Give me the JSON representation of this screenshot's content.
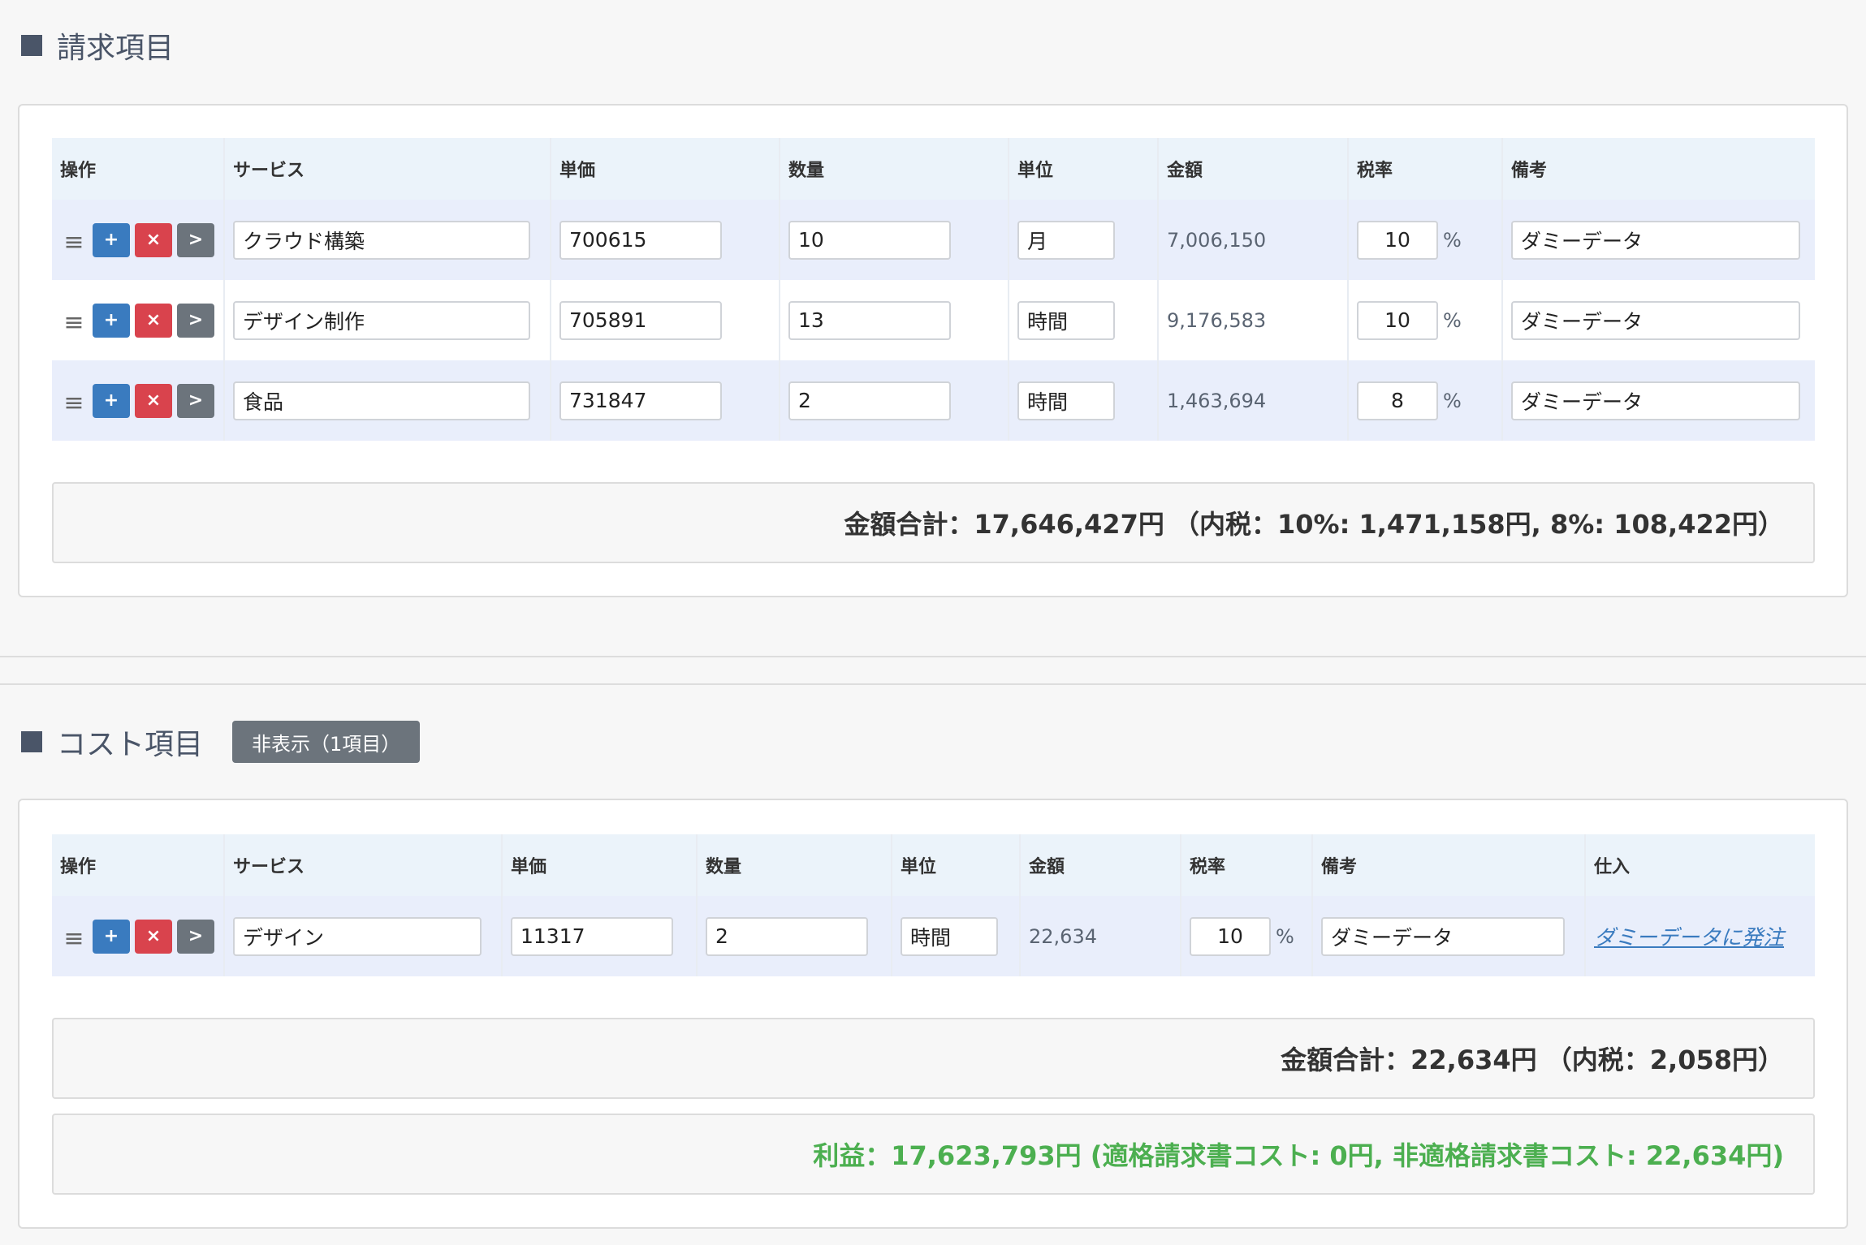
{
  "billing": {
    "title": "請求項目",
    "headers": [
      "操作",
      "サービス",
      "単価",
      "数量",
      "単位",
      "金額",
      "税率",
      "備考"
    ],
    "rows": [
      {
        "service": "クラウド構築",
        "unit_price": "700615",
        "qty": "10",
        "unit": "月",
        "amount": "7,006,150",
        "tax": "10",
        "note": "ダミーデータ"
      },
      {
        "service": "デザイン制作",
        "unit_price": "705891",
        "qty": "13",
        "unit": "時間",
        "amount": "9,176,583",
        "tax": "10",
        "note": "ダミーデータ"
      },
      {
        "service": "食品",
        "unit_price": "731847",
        "qty": "2",
        "unit": "時間",
        "amount": "1,463,694",
        "tax": "8",
        "note": "ダミーデータ"
      }
    ],
    "total": "金額合計：17,646,427円 （内税：10%: 1,471,158円, 8%: 108,422円）"
  },
  "cost": {
    "title": "コスト項目",
    "toggle_label": "非表示（1項目）",
    "headers": [
      "操作",
      "サービス",
      "単価",
      "数量",
      "単位",
      "金額",
      "税率",
      "備考",
      "仕入"
    ],
    "rows": [
      {
        "service": "デザイン",
        "unit_price": "11317",
        "qty": "2",
        "unit": "時間",
        "amount": "22,634",
        "tax": "10",
        "note": "ダミーデータ",
        "purchase": "ダミーデータに発注"
      }
    ],
    "total": "金額合計：22,634円 （内税：2,058円）",
    "profit": "利益：17,623,793円 (適格請求書コスト: 0円, 非適格請求書コスト: 22,634円)"
  },
  "controls": {
    "add": "+",
    "delete": "×",
    "next": ">",
    "drag": "≡",
    "percent": "%"
  },
  "icons": {
    "drag": "drag-handle-icon",
    "add": "plus-icon",
    "delete": "close-icon",
    "next": "chevron-right-icon"
  }
}
